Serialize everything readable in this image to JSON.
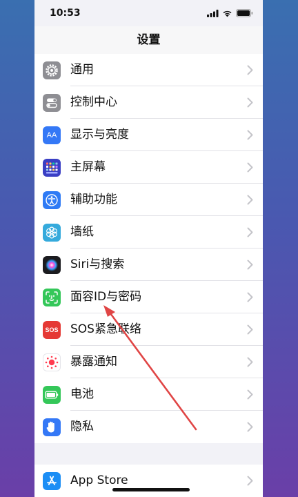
{
  "status_bar": {
    "time": "10:53"
  },
  "nav": {
    "title": "设置"
  },
  "settings_group_1": [
    {
      "label": "通用",
      "icon": "gear-icon",
      "color": "#8e8e93"
    },
    {
      "label": "控制中心",
      "icon": "toggles-icon",
      "color": "#8e8e93"
    },
    {
      "label": "显示与亮度",
      "icon": "text-size-icon",
      "icon_text": "AA",
      "color": "#3478f6"
    },
    {
      "label": "主屏幕",
      "icon": "home-grid-icon",
      "color": "#3a3fc4"
    },
    {
      "label": "辅助功能",
      "icon": "accessibility-icon",
      "color": "#2f7bf5"
    },
    {
      "label": "墙纸",
      "icon": "flower-icon",
      "color": "#35aadc"
    },
    {
      "label": "Siri与搜索",
      "icon": "siri-icon",
      "color": "#1b1b1f"
    },
    {
      "label": "面容ID与密码",
      "icon": "face-id-icon",
      "color": "#34c759"
    },
    {
      "label": "SOS紧急联络",
      "icon": "sos-icon",
      "icon_text": "SOS",
      "color": "#e53935"
    },
    {
      "label": "暴露通知",
      "icon": "exposure-icon",
      "color": "#ffffff"
    },
    {
      "label": "电池",
      "icon": "battery-icon",
      "color": "#34c759"
    },
    {
      "label": "隐私",
      "icon": "hand-icon",
      "color": "#3478f6"
    }
  ],
  "settings_group_2": [
    {
      "label": "App Store",
      "icon": "app-store-icon",
      "color": "#1c8ef5"
    }
  ],
  "annotation": {
    "color": "#e04545"
  }
}
